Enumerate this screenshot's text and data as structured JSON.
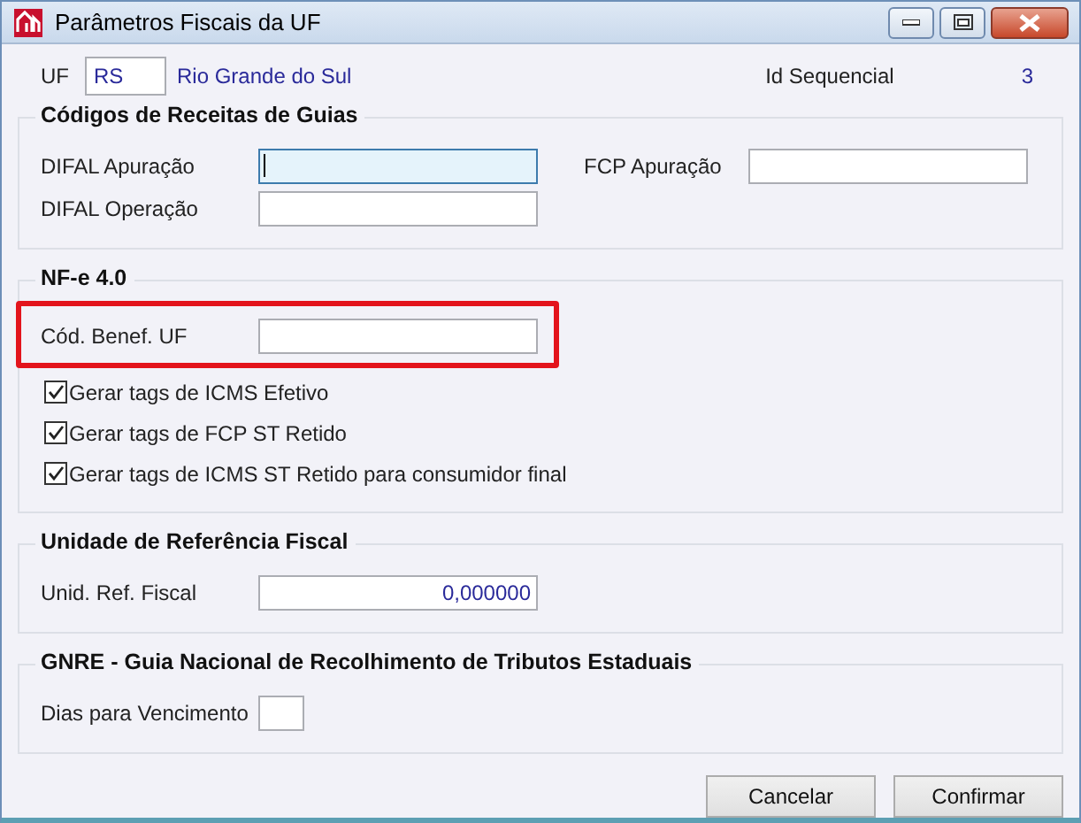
{
  "window": {
    "title": "Parâmetros Fiscais da UF"
  },
  "header": {
    "uf_label": "UF",
    "uf_value": "RS",
    "uf_name": "Rio Grande do Sul",
    "id_label": "Id Sequencial",
    "id_value": "3"
  },
  "groups": [
    {
      "title": "Códigos de Receitas de Guias",
      "items": [
        {
          "kind": "text",
          "label": "DIFAL Apuração",
          "focused": true,
          "highlighted": false
        },
        {
          "kind": "text",
          "label": "FCP Apuração",
          "focused": false,
          "highlighted": false
        },
        {
          "kind": "text",
          "label": "DIFAL Operação",
          "focused": false,
          "highlighted": false
        }
      ]
    },
    {
      "title": "NF-e 4.0",
      "items": [
        {
          "kind": "text",
          "label": "Cód. Benef. UF",
          "focused": false,
          "highlighted": true
        },
        {
          "kind": "checkbox",
          "label": "Gerar tags de ICMS Efetivo",
          "checked": true
        },
        {
          "kind": "checkbox",
          "label": "Gerar tags de FCP ST Retido",
          "checked": true
        },
        {
          "kind": "checkbox",
          "label": "Gerar tags de ICMS ST Retido para consumidor final",
          "checked": true
        }
      ]
    },
    {
      "title": "Unidade de Referência Fiscal",
      "items": [
        {
          "kind": "number",
          "label": "Unid. Ref. Fiscal",
          "value": "0,000000",
          "focused": false,
          "highlighted": false
        }
      ]
    },
    {
      "title": "GNRE - Guia Nacional de Recolhimento de Tributos Estaduais",
      "items": [
        {
          "kind": "short",
          "label": "Dias para Vencimento",
          "focused": false,
          "highlighted": false
        }
      ]
    }
  ],
  "buttons": [
    "Cancelar",
    "Confirmar"
  ]
}
